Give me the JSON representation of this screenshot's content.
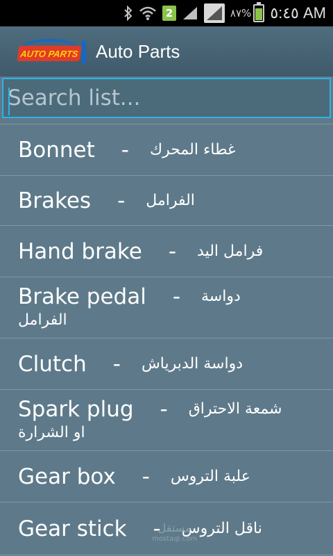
{
  "status_bar": {
    "badge": "2",
    "battery_pct": "٨٧%",
    "battery_level": 0.87,
    "time": "٥:٤٥ AM",
    "icons": [
      "bluetooth-icon",
      "wifi-icon",
      "signal-icon",
      "signal-icon-2"
    ]
  },
  "action_bar": {
    "logo_text": "AUTO PARTS",
    "title": "Auto Parts"
  },
  "search": {
    "placeholder": "Search list..."
  },
  "items": [
    {
      "en": "Bonnet",
      "dash": "-",
      "ar": "غطاء المحرك",
      "ar2": ""
    },
    {
      "en": "Brakes",
      "dash": "-",
      "ar": "الفرامل",
      "ar2": ""
    },
    {
      "en": "Hand brake",
      "dash": "-",
      "ar": "فرامل اليد",
      "ar2": ""
    },
    {
      "en": "Brake pedal",
      "dash": "-",
      "ar": "دواسة",
      "ar2": "الفرامل"
    },
    {
      "en": "Clutch",
      "dash": "-",
      "ar": "دواسة الدبرياش",
      "ar2": ""
    },
    {
      "en": "Spark plug",
      "dash": "-",
      "ar": "شمعة الاحتراق",
      "ar2": "او الشرارة"
    },
    {
      "en": "Gear box",
      "dash": "-",
      "ar": "علبة التروس",
      "ar2": ""
    },
    {
      "en": "Gear stick",
      "dash": "-",
      "ar": "ناقل التروس",
      "ar2": ""
    }
  ],
  "watermark": {
    "ar": "مستقل",
    "en": "mostaql.com"
  },
  "colors": {
    "background": "#5e7a8a",
    "accent": "#2db3e6",
    "badge": "#8bc34a"
  }
}
